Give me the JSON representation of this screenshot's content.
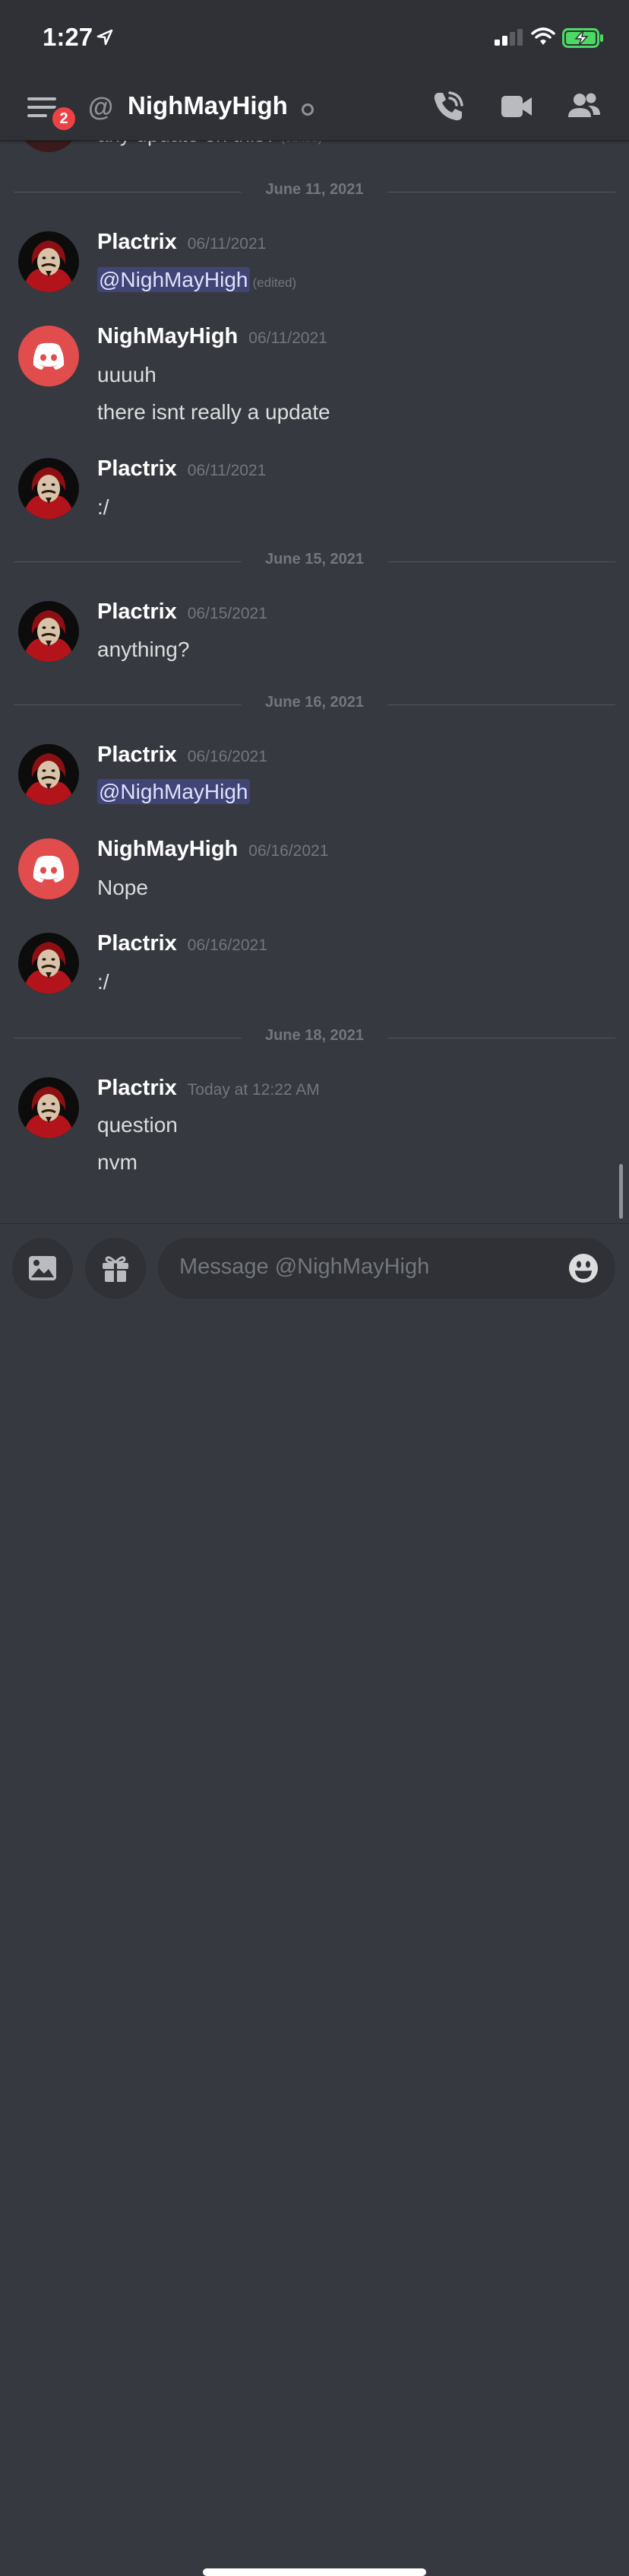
{
  "status_bar": {
    "time": "1:27"
  },
  "header": {
    "unread_badge": "2",
    "channel_prefix": "@",
    "channel_name": "NighMayHigh"
  },
  "partial_message": {
    "text": "any update on this?",
    "edited": "(edited)"
  },
  "messages_region": [
    {
      "type": "divider",
      "text": "June 11, 2021"
    },
    {
      "type": "message",
      "author": "Plactrix",
      "avatar": "plactrix-avatar",
      "time": "06/11/2021",
      "lines": [
        {
          "mention": "@NighMayHigh",
          "edited": "(edited)"
        }
      ]
    },
    {
      "type": "message",
      "author": "NighMayHigh",
      "avatar": "discord-logo",
      "time": "06/11/2021",
      "lines": [
        {
          "text": "uuuuh"
        },
        {
          "text": "there isnt really a update"
        }
      ]
    },
    {
      "type": "message",
      "author": "Plactrix",
      "avatar": "plactrix-avatar",
      "time": "06/11/2021",
      "lines": [
        {
          "text": ":/"
        }
      ]
    },
    {
      "type": "divider",
      "text": "June 15, 2021"
    },
    {
      "type": "message",
      "author": "Plactrix",
      "avatar": "plactrix-avatar",
      "time": "06/15/2021",
      "lines": [
        {
          "text": "anything?"
        }
      ]
    },
    {
      "type": "divider",
      "text": "June 16, 2021"
    },
    {
      "type": "message",
      "author": "Plactrix",
      "avatar": "plactrix-avatar",
      "time": "06/16/2021",
      "lines": [
        {
          "mention": "@NighMayHigh"
        }
      ]
    },
    {
      "type": "message",
      "author": "NighMayHigh",
      "avatar": "discord-logo",
      "time": "06/16/2021",
      "lines": [
        {
          "text": "Nope"
        }
      ]
    },
    {
      "type": "message",
      "author": "Plactrix",
      "avatar": "plactrix-avatar",
      "time": "06/16/2021",
      "lines": [
        {
          "text": ":/"
        }
      ]
    },
    {
      "type": "divider",
      "text": "June 18, 2021"
    },
    {
      "type": "message",
      "author": "Plactrix",
      "avatar": "plactrix-avatar",
      "time": "Today at 12:22 AM",
      "lines": [
        {
          "text": "question"
        },
        {
          "text": "nvm"
        }
      ]
    }
  ],
  "composer": {
    "placeholder": "Message @NighMayHigh"
  },
  "colors": {
    "background": "#36393f",
    "header": "#2f3136",
    "badge": "#ed4245",
    "discord_red": "#e14c4c",
    "mention": "#5865f2"
  },
  "icons": [
    "location-arrow-icon",
    "signal-icon",
    "wifi-icon",
    "battery-charging-icon",
    "hamburger-menu-icon",
    "phone-call-icon",
    "video-camera-icon",
    "members-icon",
    "image-icon",
    "gift-icon",
    "emoji-icon"
  ]
}
